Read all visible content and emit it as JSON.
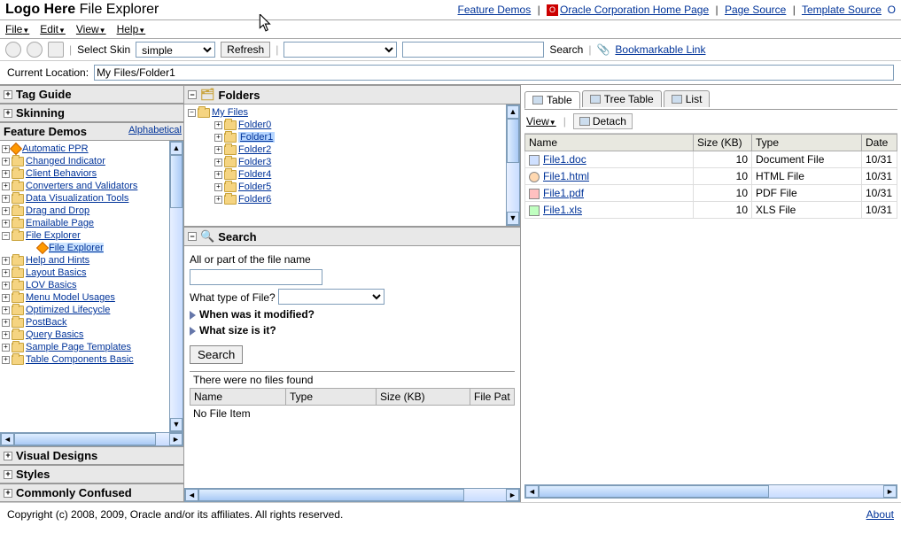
{
  "header": {
    "logo": "Logo Here",
    "title": "File Explorer",
    "links": {
      "feature_demos": "Feature Demos",
      "oracle_home": "Oracle Corporation Home Page",
      "page_source": "Page Source",
      "template_source": "Template Source",
      "o": "O"
    }
  },
  "menubar": {
    "file": "File",
    "edit": "Edit",
    "view": "View",
    "help": "Help"
  },
  "toolbar": {
    "select_skin_label": "Select Skin",
    "skin_value": "simple",
    "refresh_label": "Refresh",
    "search_label": "Search",
    "bookmarkable": "Bookmarkable Link"
  },
  "location": {
    "label": "Current Location:",
    "value": "My Files/Folder1"
  },
  "left_nav": {
    "sections": {
      "tag_guide": "Tag Guide",
      "skinning": "Skinning",
      "feature_demos": "Feature Demos",
      "visual_designs": "Visual Designs",
      "styles": "Styles",
      "commonly_confused": "Commonly Confused"
    },
    "alphabetical": "Alphabetical",
    "tree": [
      "Automatic PPR",
      "Changed Indicator",
      "Client Behaviors",
      "Converters and Validators",
      "Data Visualization Tools",
      "Drag and Drop",
      "Emailable Page",
      "File Explorer",
      "File Explorer",
      "Help and Hints",
      "Layout Basics",
      "LOV Basics",
      "Menu Model Usages",
      "Optimized Lifecycle",
      "PostBack",
      "Query Basics",
      "Sample Page Templates",
      "Table Components Basic"
    ]
  },
  "folders": {
    "title": "Folders",
    "root": "My Files",
    "items": [
      "Folder0",
      "Folder1",
      "Folder2",
      "Folder3",
      "Folder4",
      "Folder5",
      "Folder6"
    ],
    "selected": "Folder1"
  },
  "search": {
    "title": "Search",
    "name_label": "All or part of the file name",
    "type_label": "What type of File?",
    "modified_label": "When was it modified?",
    "size_label": "What size is it?",
    "button": "Search",
    "no_files_msg": "There were no files found",
    "cols": {
      "name": "Name",
      "type": "Type",
      "size": "Size (KB)",
      "path": "File Pat"
    },
    "empty_row": "No File Item"
  },
  "right": {
    "tabs": {
      "table": "Table",
      "tree_table": "Tree Table",
      "list": "List"
    },
    "view_btn": "View",
    "detach_btn": "Detach",
    "cols": {
      "name": "Name",
      "size": "Size (KB)",
      "type": "Type",
      "date": "Date"
    },
    "rows": [
      {
        "name": "File1.doc",
        "icon": "doc",
        "size": 10,
        "type": "Document File",
        "date": "10/31"
      },
      {
        "name": "File1.html",
        "icon": "html",
        "size": 10,
        "type": "HTML File",
        "date": "10/31"
      },
      {
        "name": "File1.pdf",
        "icon": "pdf",
        "size": 10,
        "type": "PDF File",
        "date": "10/31"
      },
      {
        "name": "File1.xls",
        "icon": "xls",
        "size": 10,
        "type": "XLS File",
        "date": "10/31"
      }
    ]
  },
  "footer": {
    "copyright": "Copyright (c) 2008, 2009, Oracle and/or its affiliates. All rights reserved.",
    "about": "About"
  }
}
